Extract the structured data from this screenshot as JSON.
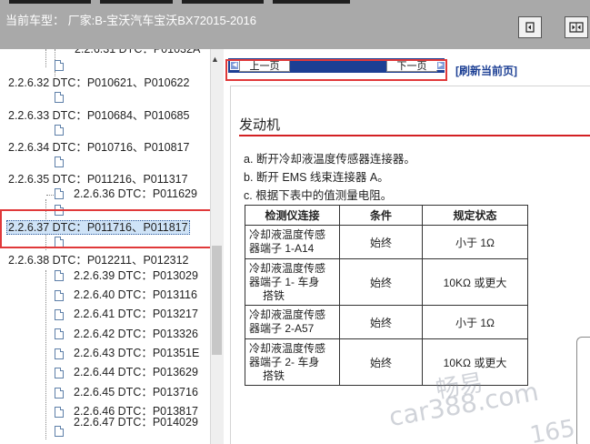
{
  "header": {
    "title": "当前车型： 厂家:B-宝沃汽车宝沃BX72015-2016",
    "nav_buttons": [
      "pin-icon",
      "split-view-icon"
    ]
  },
  "tree": {
    "top_partial": "2.2.6.31 DTC：P01032A",
    "items": [
      {
        "label": "2.2.6.32 DTC：P010621、P010622"
      },
      {
        "label": "2.2.6.33 DTC：P010684、P010685"
      },
      {
        "label": "2.2.6.34 DTC：P010716、P010817"
      },
      {
        "label": "2.2.6.35 DTC：P011216、P011317"
      },
      {
        "label": "2.2.6.36 DTC：P011629"
      },
      {
        "label": "2.2.6.37 DTC：P011716、P011817"
      },
      {
        "label": "2.2.6.38 DTC：P012211、P012312"
      },
      {
        "label": "2.2.6.39 DTC：P013029"
      },
      {
        "label": "2.2.6.40 DTC：P013116"
      },
      {
        "label": "2.2.6.41 DTC：P013217"
      },
      {
        "label": "2.2.6.42 DTC：P013326"
      },
      {
        "label": "2.2.6.43 DTC：P01351E"
      },
      {
        "label": "2.2.6.44 DTC：P013629"
      },
      {
        "label": "2.2.6.45 DTC：P013716"
      },
      {
        "label": "2.2.6.46 DTC：P013817"
      },
      {
        "label": "2.2.6.47 DTC：P014029"
      }
    ],
    "selected_index": 5
  },
  "doc": {
    "prev_label": "上一页",
    "next_label": "下一页",
    "refresh_label": "[刷新当前页]",
    "section_title": "发动机",
    "steps": [
      "a. 断开冷却液温度传感器连接器。",
      "b. 断开 EMS 线束连接器 A。",
      "c. 根据下表中的值测量电阻。"
    ],
    "table": {
      "headers": [
        "检测仪连接",
        "条件",
        "规定状态"
      ],
      "rows": [
        {
          "c1": [
            "冷却液温度传感",
            "器端子 1-A14"
          ],
          "c2": "始终",
          "c3": "小于 1Ω"
        },
        {
          "c1": [
            "冷却液温度传感",
            "器端子 1- 车身",
            "搭铁"
          ],
          "c2": "始终",
          "c3": "10KΩ 或更大"
        },
        {
          "c1": [
            "冷却液温度传感",
            "器端子 2-A57"
          ],
          "c2": "始终",
          "c3": "小于 1Ω"
        },
        {
          "c1": [
            "冷却液温度传感",
            "器端子 2- 车身",
            "搭铁"
          ],
          "c2": "始终",
          "c3": "10KΩ 或更大"
        }
      ]
    },
    "watermark_lines": [
      "畅易",
      "car388.com",
      "165"
    ]
  },
  "colors": {
    "accent_red": "#e0393a",
    "pager_blue": "#1c3f94",
    "section_rule": "#d32023",
    "header_gray": "#a9a9a9"
  }
}
